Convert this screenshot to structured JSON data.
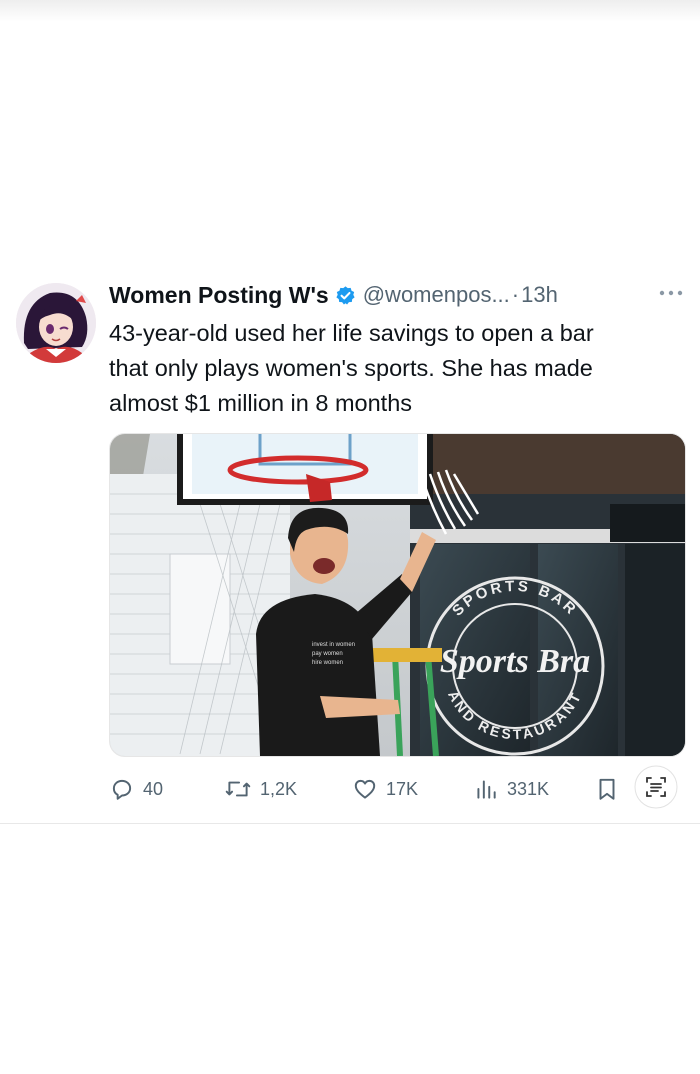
{
  "tweet": {
    "display_name": "Women Posting W's",
    "handle": "@womenpos...",
    "separator": "·",
    "time": "13h",
    "text_lines": [
      "43-year-old used her life savings to open a bar",
      "that only plays women's sports. She has made",
      "almost $1 million in 8 months"
    ],
    "media": {
      "shirt_lines": [
        "invest in women",
        "pay women",
        "hire women"
      ],
      "window_sign_ring_top": "SPORTS BAR",
      "window_sign_ring_bottom": "AND RESTAURANT",
      "window_sign_center": "Sports Bra"
    },
    "actions": {
      "replies": "40",
      "reposts": "1,2K",
      "likes": "17K",
      "views": "331K"
    },
    "icons": {
      "verified": "verified-badge-icon",
      "more": "more-options-icon",
      "reply": "reply-icon",
      "repost": "repost-icon",
      "like": "heart-icon",
      "views": "views-icon",
      "bookmark": "bookmark-icon",
      "scan": "text-scan-icon"
    },
    "colors": {
      "text": "#0f1419",
      "muted": "#536471",
      "verified": "#1d9bf0"
    }
  }
}
